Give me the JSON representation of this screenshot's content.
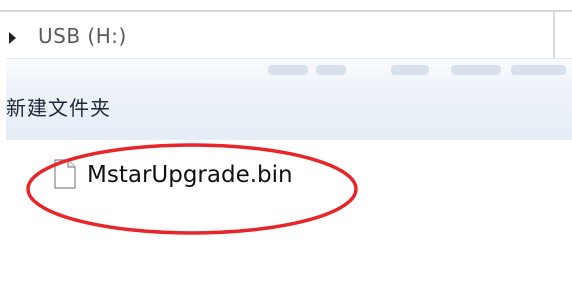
{
  "nav": {
    "drive_label": "USB (H:)",
    "expand_icon": "triangle-right-icon"
  },
  "toolbar": {
    "new_folder_label": "新建文件夹"
  },
  "files": [
    {
      "name": "MstarUpgrade.bin",
      "icon": "file-icon"
    }
  ],
  "annotation": {
    "color": "#e8262a",
    "shape": "ellipse"
  }
}
